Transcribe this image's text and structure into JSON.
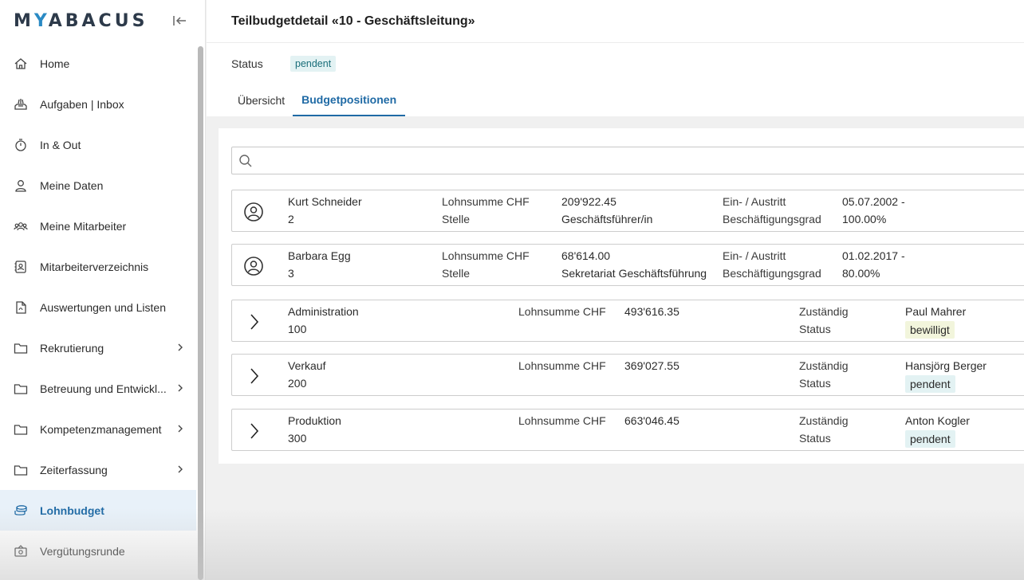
{
  "brand": {
    "logo_part1": "M",
    "logo_part2": "Y",
    "logo_part3": "ABACUS"
  },
  "sidebar": {
    "items": [
      {
        "label": "Home",
        "icon": "home-icon"
      },
      {
        "label": "Aufgaben | Inbox",
        "icon": "inbox-icon"
      },
      {
        "label": "In & Out",
        "icon": "stopwatch-icon"
      },
      {
        "label": "Meine Daten",
        "icon": "person-icon"
      },
      {
        "label": "Meine Mitarbeiter",
        "icon": "team-icon"
      },
      {
        "label": "Mitarbeiterverzeichnis",
        "icon": "directory-icon"
      },
      {
        "label": "Auswertungen und Listen",
        "icon": "report-icon"
      },
      {
        "label": "Rekrutierung",
        "icon": "folder-icon"
      },
      {
        "label": "Betreuung und Entwickl...",
        "icon": "folder-icon"
      },
      {
        "label": "Kompetenzmanagement",
        "icon": "folder-icon"
      },
      {
        "label": "Zeiterfassung",
        "icon": "folder-icon"
      },
      {
        "label": "Lohnbudget",
        "icon": "coins-icon"
      },
      {
        "label": "Vergütungsrunde",
        "icon": "money-icon"
      }
    ]
  },
  "header": {
    "title": "Teilbudgetdetail «10 - Geschäftsleitung»"
  },
  "status": {
    "label": "Status",
    "value": "pendent"
  },
  "tabs": [
    {
      "label": "Übersicht"
    },
    {
      "label": "Budgetpositionen"
    }
  ],
  "search": {
    "placeholder": ""
  },
  "employees": [
    {
      "name": "Kurt Schneider",
      "number": "2",
      "l1": "Lohnsumme CHF",
      "l2": "Stelle",
      "v1": "209'922.45",
      "v2": "Geschäftsführer/in",
      "l3": "Ein- / Austritt",
      "l4": "Beschäftigungsgrad",
      "v3": "05.07.2002 -",
      "v4": "100.00%"
    },
    {
      "name": "Barbara Egg",
      "number": "3",
      "l1": "Lohnsumme CHF",
      "l2": "Stelle",
      "v1": "68'614.00",
      "v2": "Sekretariat Geschäftsführung",
      "l3": "Ein- / Austritt",
      "l4": "Beschäftigungsgrad",
      "v3": "01.02.2017 -",
      "v4": "80.00%"
    }
  ],
  "units": [
    {
      "name": "Administration",
      "number": "100",
      "l1": "Lohnsumme CHF",
      "v1": "493'616.35",
      "l2": "Zuständig",
      "l3": "Status",
      "owner": "Paul Mahrer",
      "status": "bewilligt"
    },
    {
      "name": "Verkauf",
      "number": "200",
      "l1": "Lohnsumme CHF",
      "v1": "369'027.55",
      "l2": "Zuständig",
      "l3": "Status",
      "owner": "Hansjörg Berger",
      "status": "pendent"
    },
    {
      "name": "Produktion",
      "number": "300",
      "l1": "Lohnsumme CHF",
      "v1": "663'046.45",
      "l2": "Zuständig",
      "l3": "Status",
      "owner": "Anton Kogler",
      "status": "pendent"
    }
  ],
  "colors": {
    "accent": "#1f6aa5",
    "pending_bg": "#e3f2f3",
    "approved_bg": "#f2f5dc"
  }
}
